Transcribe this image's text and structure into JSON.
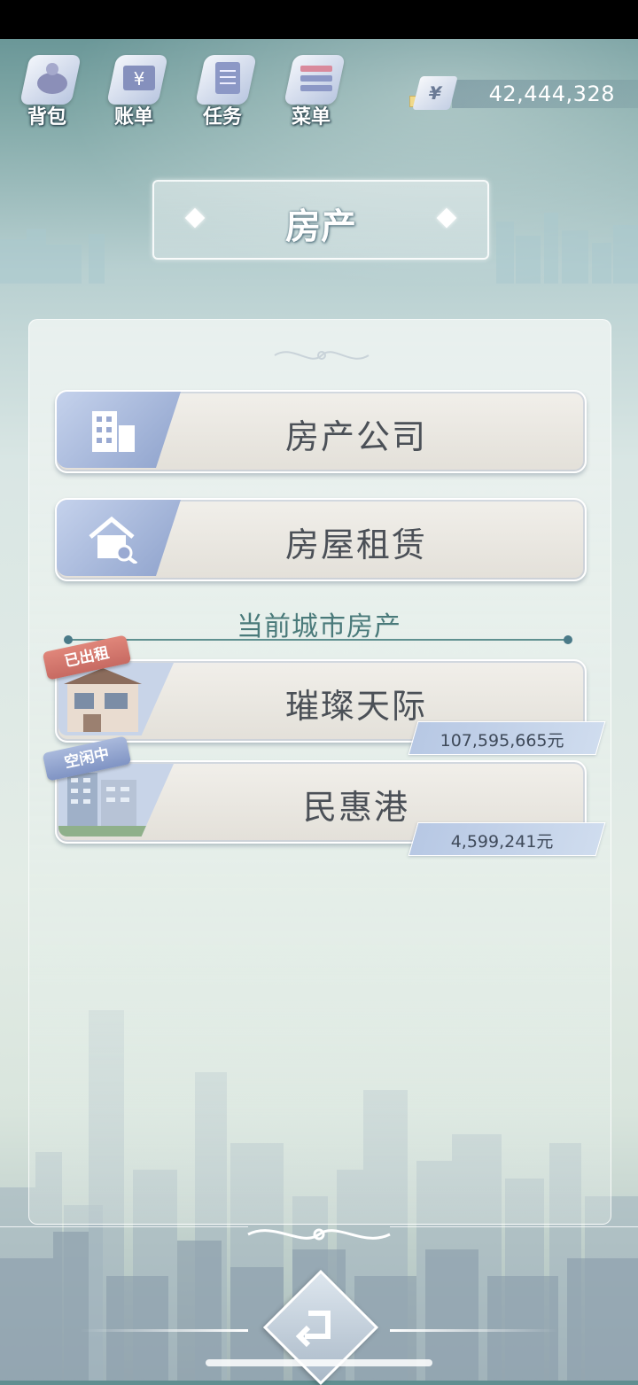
{
  "top_bar": {
    "buttons": [
      {
        "label": "背包",
        "icon": "bag-icon"
      },
      {
        "label": "账单",
        "icon": "bill-icon"
      },
      {
        "label": "任务",
        "icon": "task-icon"
      },
      {
        "label": "菜单",
        "icon": "menu-icon"
      }
    ],
    "money": {
      "symbol": "¥",
      "value": "42,444,328"
    }
  },
  "page_title": "房产",
  "menu_cards": [
    {
      "label": "房产公司",
      "icon": "office-building-icon"
    },
    {
      "label": "房屋租赁",
      "icon": "house-search-icon"
    }
  ],
  "section_title": "当前城市房产",
  "properties": [
    {
      "name": "璀璨天际",
      "status": "已出租",
      "price": "107,595,665元"
    },
    {
      "name": "民惠港",
      "status": "空闲中",
      "price": "4,599,241元"
    }
  ],
  "colors": {
    "accent_teal": "#4a7a7a",
    "badge_rented": "#d4766c",
    "badge_idle": "#8ea0cc"
  }
}
